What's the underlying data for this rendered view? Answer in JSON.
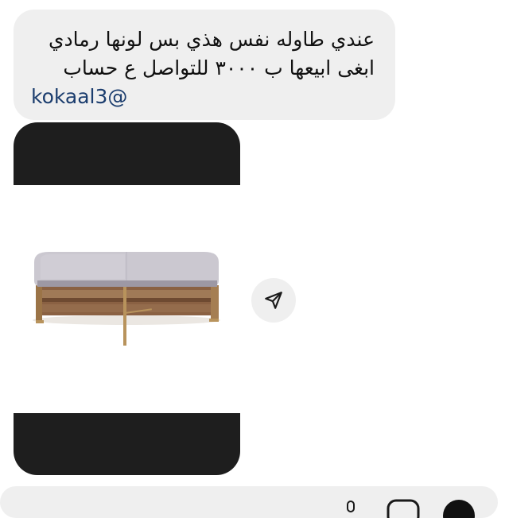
{
  "message": {
    "line1": "عندي طاوله نفس هذي بس لونها رمادي",
    "line2": "ابغى ابيعها ب ٣٠٠٠ للتواصل ع حساب",
    "handle": "kokaal3@"
  },
  "shared_post": {
    "image_subject": "coffee-table"
  },
  "icons": {
    "share": "send-icon",
    "mic": "microphone-icon",
    "gallery": "gallery-icon",
    "sticker": "sticker-icon"
  },
  "colors": {
    "bubble": "#efefef",
    "handle": "#1b3d6e",
    "media_frame": "#1e1e1e"
  }
}
